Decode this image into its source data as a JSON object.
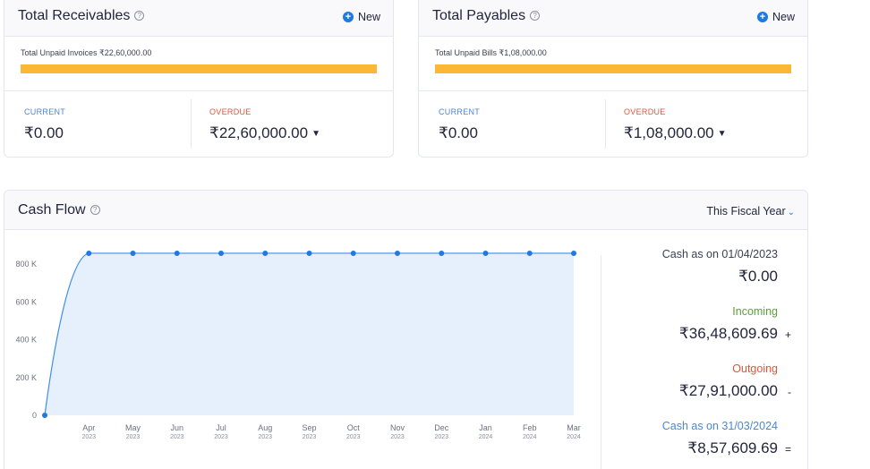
{
  "receivables": {
    "title": "Total Receivables",
    "new_label": "New",
    "unpaid_label": "Total Unpaid Invoices ₹22,60,000.00",
    "unpaid_fill_fraction": 1.0,
    "current_label": "CURRENT",
    "current_value": "₹0.00",
    "overdue_label": "OVERDUE",
    "overdue_value": "₹22,60,000.00"
  },
  "payables": {
    "title": "Total Payables",
    "new_label": "New",
    "unpaid_label": "Total Unpaid Bills ₹1,08,000.00",
    "unpaid_fill_fraction": 1.0,
    "current_label": "CURRENT",
    "current_value": "₹0.00",
    "overdue_label": "OVERDUE",
    "overdue_value": "₹1,08,000.00"
  },
  "cashflow": {
    "title": "Cash Flow",
    "period_select": "This Fiscal Year",
    "opening_label": "Cash as on 01/04/2023",
    "opening_value": "₹0.00",
    "incoming_label": "Incoming",
    "incoming_value": "₹36,48,609.69",
    "incoming_sign": "+",
    "outgoing_label": "Outgoing",
    "outgoing_value": "₹27,91,000.00",
    "outgoing_sign": "-",
    "closing_label": "Cash as on 31/03/2024",
    "closing_value": "₹8,57,609.69",
    "closing_sign": "="
  },
  "colors": {
    "accent": "#1f7ae0",
    "bar": "#fbb836",
    "incoming": "#5c9e3a",
    "outgoing": "#e0553a",
    "closing": "#4b86d6",
    "area_fill": "#e6f0fd",
    "line": "#3f8ee8"
  },
  "chart_data": {
    "type": "area",
    "x": [
      "",
      "Apr",
      "May",
      "Jun",
      "Jul",
      "Aug",
      "Sep",
      "Oct",
      "Nov",
      "Dec",
      "Jan",
      "Feb",
      "Mar"
    ],
    "x_years": [
      "",
      "2023",
      "2023",
      "2023",
      "2023",
      "2023",
      "2023",
      "2023",
      "2023",
      "2023",
      "2024",
      "2024",
      "2024"
    ],
    "values": [
      0,
      857609.69,
      857609.69,
      857609.69,
      857609.69,
      857609.69,
      857609.69,
      857609.69,
      857609.69,
      857609.69,
      857609.69,
      857609.69,
      857609.69
    ],
    "yticks": [
      0,
      200000,
      400000,
      600000,
      800000
    ],
    "ytick_labels": [
      "0",
      "200 K",
      "400 K",
      "600 K",
      "800 K"
    ],
    "ylim": [
      0,
      900000
    ],
    "grid": false,
    "legend": "none"
  }
}
